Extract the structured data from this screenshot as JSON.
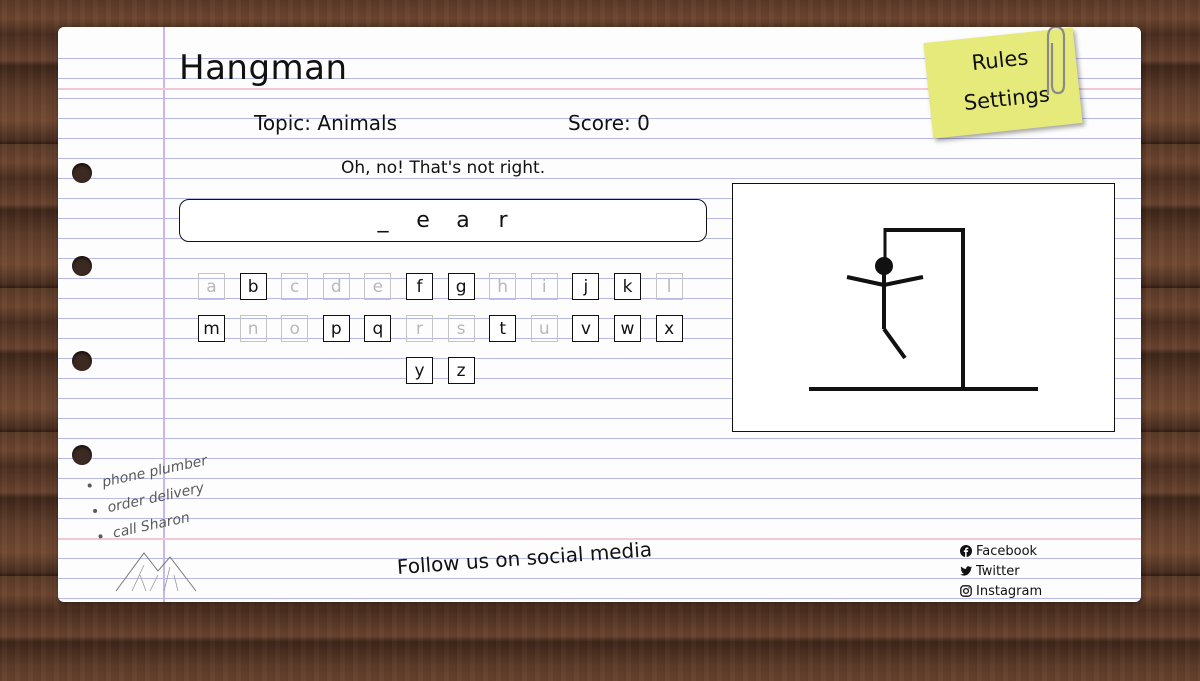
{
  "game": {
    "title": "Hangman",
    "topic_text": "Topic: Animals",
    "score_text": "Score: 0",
    "message": "Oh, no! That's not right.",
    "word_display": [
      "_",
      "e",
      "a",
      "r"
    ]
  },
  "menu": {
    "rules_label": "Rules",
    "settings_label": "Settings"
  },
  "keyboard": {
    "letters": [
      {
        "char": "a",
        "used": true
      },
      {
        "char": "b",
        "used": false
      },
      {
        "char": "c",
        "used": true
      },
      {
        "char": "d",
        "used": true
      },
      {
        "char": "e",
        "used": true
      },
      {
        "char": "f",
        "used": false
      },
      {
        "char": "g",
        "used": false
      },
      {
        "char": "h",
        "used": true
      },
      {
        "char": "i",
        "used": true
      },
      {
        "char": "j",
        "used": false
      },
      {
        "char": "k",
        "used": false
      },
      {
        "char": "l",
        "used": true
      },
      {
        "char": "m",
        "used": false
      },
      {
        "char": "n",
        "used": true
      },
      {
        "char": "o",
        "used": true
      },
      {
        "char": "p",
        "used": false
      },
      {
        "char": "q",
        "used": false
      },
      {
        "char": "r",
        "used": true
      },
      {
        "char": "s",
        "used": true
      },
      {
        "char": "t",
        "used": false
      },
      {
        "char": "u",
        "used": true
      },
      {
        "char": "v",
        "used": false
      },
      {
        "char": "w",
        "used": false
      },
      {
        "char": "x",
        "used": false
      },
      {
        "char": "y",
        "used": false
      },
      {
        "char": "z",
        "used": false
      }
    ]
  },
  "hangman": {
    "wrong_guesses": 5,
    "parts_visible": [
      "head",
      "body",
      "left-arm",
      "right-arm",
      "right-leg"
    ]
  },
  "doodle_notes": [
    "phone plumber",
    "order delivery",
    "call Sharon"
  ],
  "footer": {
    "follow_text": "Follow us on social media",
    "social": [
      {
        "label": "Facebook",
        "icon": "facebook-icon"
      },
      {
        "label": "Twitter",
        "icon": "twitter-icon"
      },
      {
        "label": "Instagram",
        "icon": "instagram-icon"
      }
    ]
  },
  "colors": {
    "sticky_note": "#e6ea7a",
    "rule_line": "#b9b9e8",
    "margin_line": "#c9b6ea",
    "used_letter": "#b8b8b8"
  }
}
